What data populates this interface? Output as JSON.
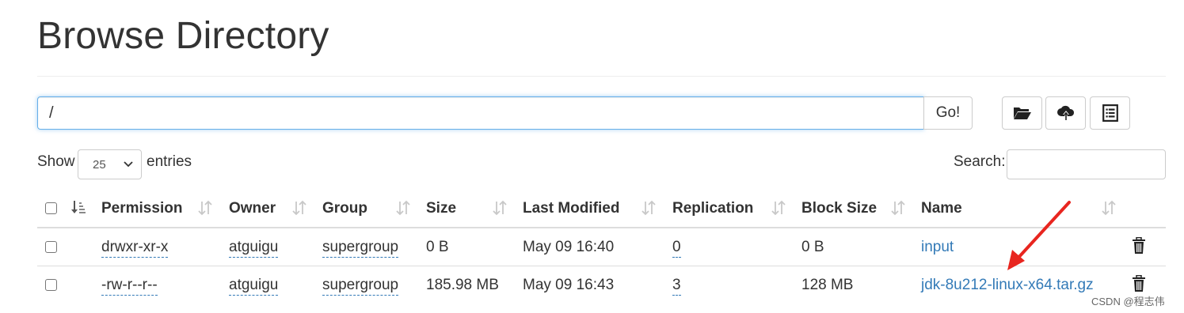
{
  "page": {
    "title": "Browse Directory"
  },
  "toolbar": {
    "path_value": "/",
    "go_label": "Go!",
    "buttons": [
      {
        "icon": "folder-open-icon"
      },
      {
        "icon": "cloud-upload-icon"
      },
      {
        "icon": "list-icon"
      }
    ]
  },
  "controls": {
    "show_label": "Show",
    "entries_selected": "25",
    "entries_label": "entries",
    "search_label": "Search:",
    "search_value": ""
  },
  "table": {
    "columns": [
      "Permission",
      "Owner",
      "Group",
      "Size",
      "Last Modified",
      "Replication",
      "Block Size",
      "Name"
    ],
    "rows": [
      {
        "permission": "drwxr-xr-x",
        "owner": "atguigu",
        "group": "supergroup",
        "size": "0 B",
        "modified": "May 09 16:40",
        "replication": "0",
        "block_size": "0 B",
        "name": "input"
      },
      {
        "permission": "-rw-r--r--",
        "owner": "atguigu",
        "group": "supergroup",
        "size": "185.98 MB",
        "modified": "May 09 16:43",
        "replication": "3",
        "block_size": "128 MB",
        "name": "jdk-8u212-linux-x64.tar.gz"
      }
    ]
  },
  "colors": {
    "link": "#337ab7",
    "annotation_arrow": "#e8251f"
  },
  "watermark": "CSDN @程志伟"
}
